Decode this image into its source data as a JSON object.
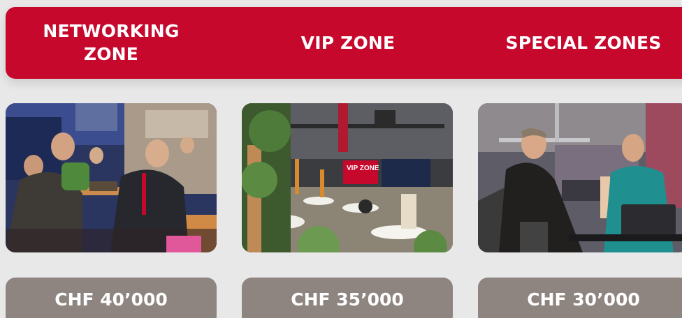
{
  "tabs": [
    {
      "line1": "NETWORKING",
      "line2": "ZONE"
    },
    {
      "label": "VIP ZONE"
    },
    {
      "label": "SPECIAL ZONES"
    }
  ],
  "photos": [
    {
      "sign_text": ""
    },
    {
      "sign_text": "VIP ZONE"
    },
    {
      "sign_text": ""
    }
  ],
  "prices": [
    "CHF 40’000",
    "CHF 35’000",
    "CHF 30’000"
  ],
  "colors": {
    "brand_red": "#c6082d",
    "price_bg": "#8e8580",
    "page_bg": "#e9e8e8",
    "text": "#ffffff"
  }
}
